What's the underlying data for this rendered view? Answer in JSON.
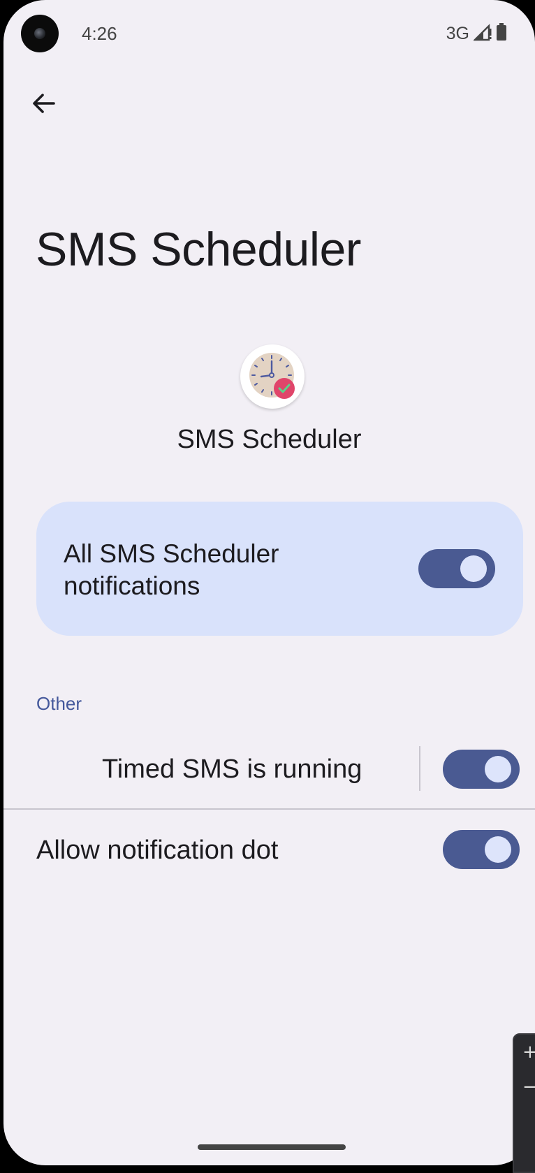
{
  "status_bar": {
    "time": "4:26",
    "network": "3G",
    "icons": [
      "signal-icon",
      "battery-icon"
    ]
  },
  "header": {
    "back_icon": "arrow-back-icon",
    "title": "SMS Scheduler"
  },
  "app": {
    "icon": "clock-check-icon",
    "name": "SMS Scheduler"
  },
  "master_toggle": {
    "label": "All SMS Scheduler notifications",
    "on": true
  },
  "sections": [
    {
      "header": "Other",
      "items": [
        {
          "label": "Timed SMS is running",
          "on": true
        },
        {
          "label": "Allow notification dot",
          "on": true
        }
      ]
    }
  ],
  "colors": {
    "background": "#f2eff5",
    "card": "#d9e2fb",
    "switch_track": "#4a5a92",
    "switch_thumb": "#dde4fb",
    "section_header": "#44589b",
    "clock_face": "#e3d3c3",
    "check_badge": "#e0456a"
  }
}
